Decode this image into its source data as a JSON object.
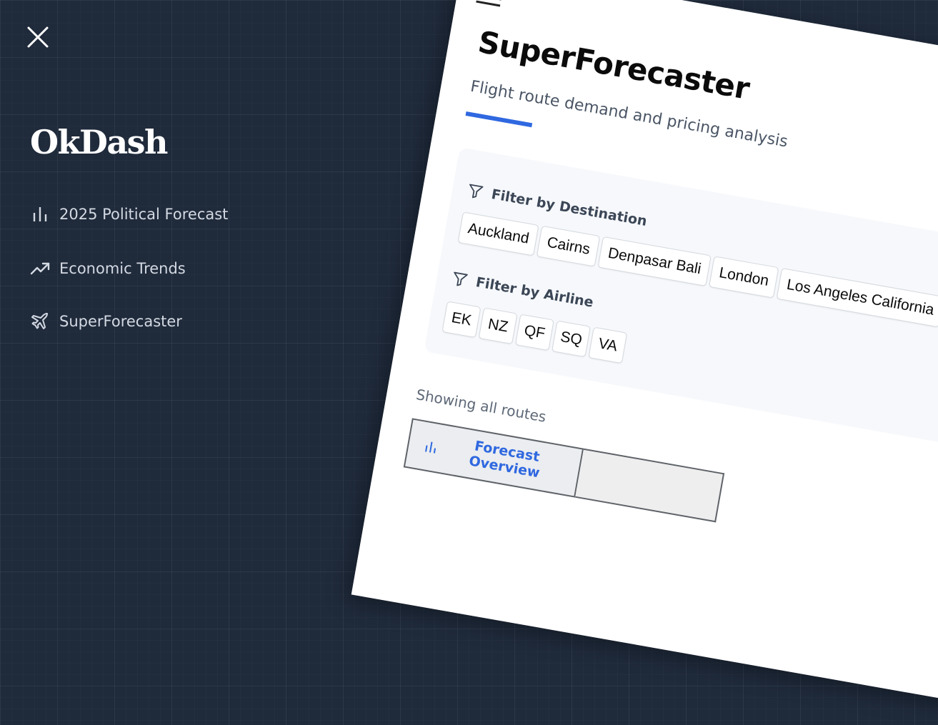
{
  "sidebar": {
    "close_icon": "close-icon",
    "brand": "OkDash",
    "text_color": "#d3d9e2",
    "items": [
      {
        "label": "2025 Political Forecast",
        "icon": "bar-chart-icon"
      },
      {
        "label": "Economic Trends",
        "icon": "trending-up-icon"
      },
      {
        "label": "SuperForecaster",
        "icon": "plane-icon"
      }
    ]
  },
  "preview": {
    "menu_icon": "hamburger-menu-icon",
    "title": "SuperForecaster",
    "subtitle": "Flight route demand and pricing analysis",
    "accent_color": "#2f68e0",
    "destination_filter": {
      "label": "Filter by Destination",
      "icon": "filter-icon",
      "options": [
        "Auckland",
        "Cairns",
        "Denpasar Bali",
        "London",
        "Los Angeles California"
      ]
    },
    "airline_filter": {
      "label": "Filter by Airline",
      "icon": "filter-icon",
      "options": [
        "EK",
        "NZ",
        "QF",
        "SQ",
        "VA"
      ]
    },
    "status": "Showing all routes",
    "tabs": [
      {
        "label": "Forecast Overview",
        "icon": "bar-chart-icon",
        "active": true
      }
    ]
  }
}
